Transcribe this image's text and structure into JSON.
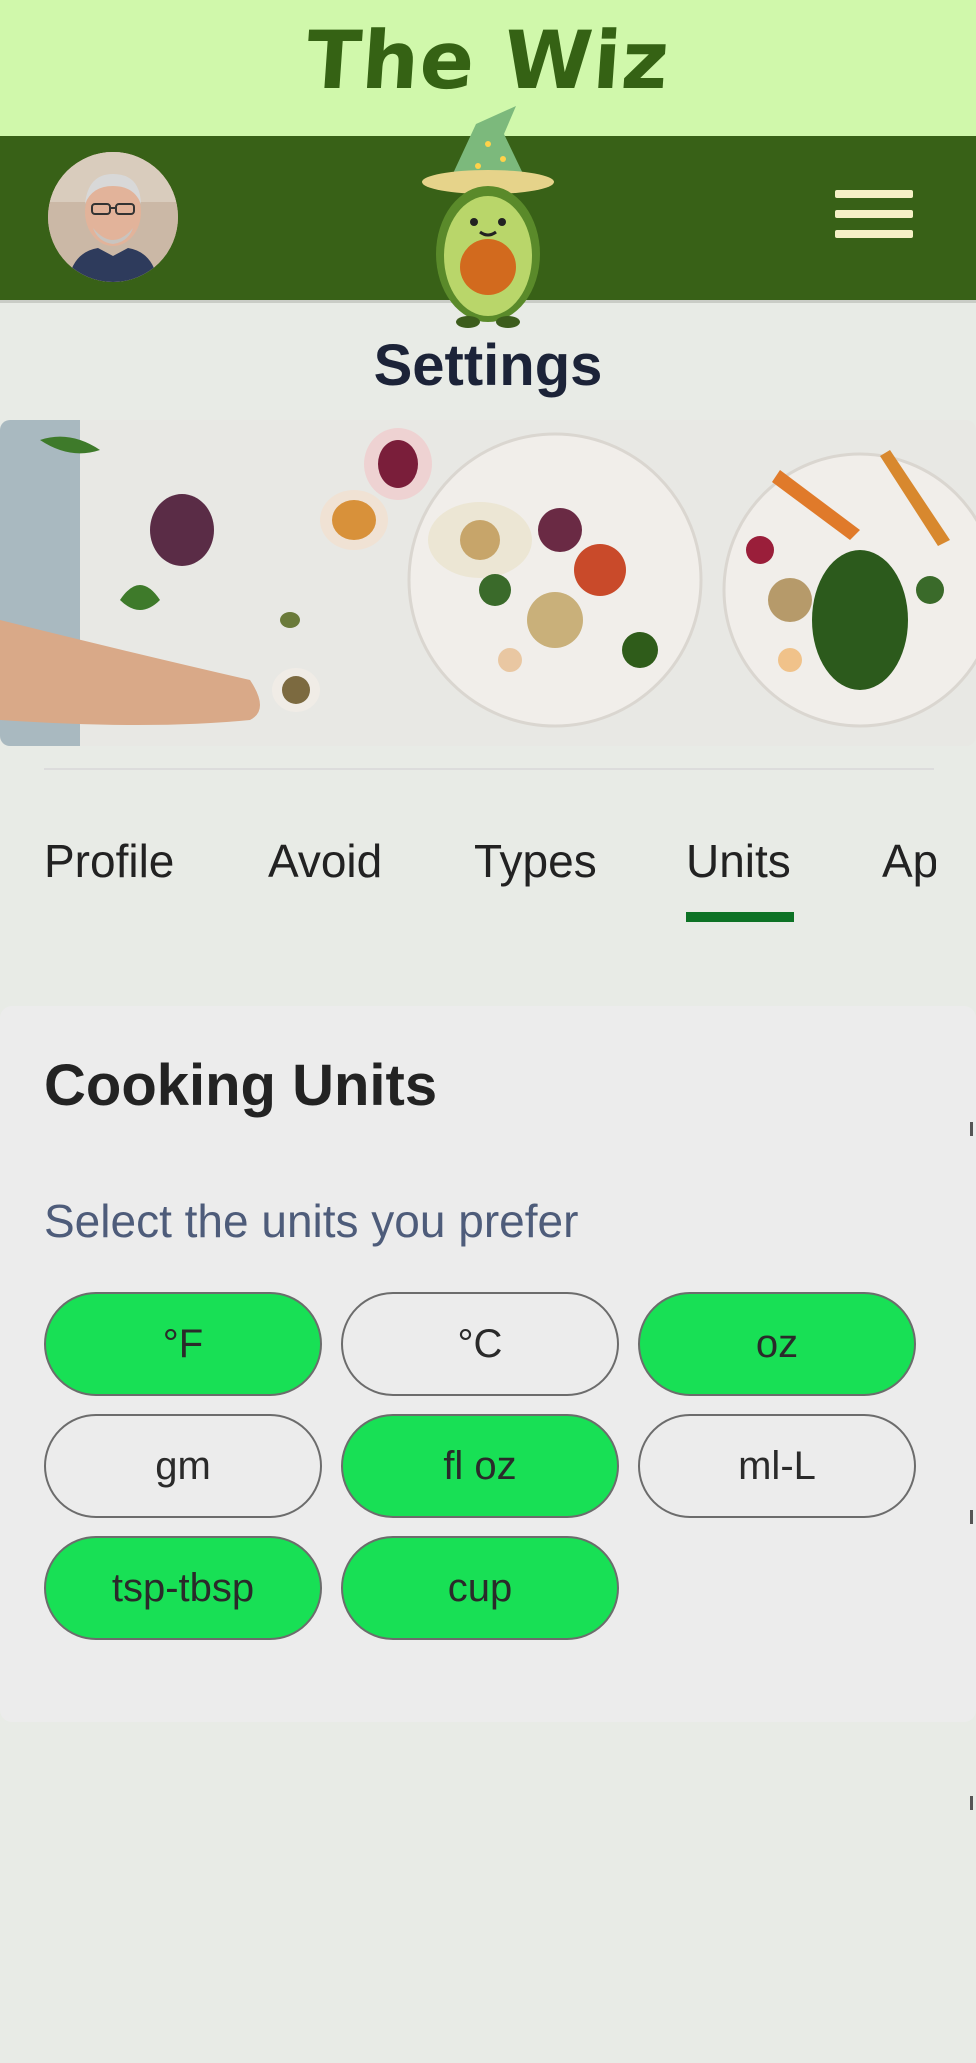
{
  "app": {
    "title": "The Wiz"
  },
  "header": {
    "avatar_alt": "user avatar",
    "menu_icon": "hamburger-menu-icon",
    "mascot": "wizard-avocado-mascot"
  },
  "page": {
    "title": "Settings"
  },
  "tabs": [
    {
      "label": "Profile",
      "selected": false
    },
    {
      "label": "Avoid",
      "selected": false
    },
    {
      "label": "Types",
      "selected": false
    },
    {
      "label": "Units",
      "selected": true
    },
    {
      "label": "Ap",
      "selected": false
    }
  ],
  "section": {
    "title": "Cooking Units",
    "subtitle": "Select the units you prefer"
  },
  "units": [
    {
      "label": "°F",
      "selected": true
    },
    {
      "label": "°C",
      "selected": false
    },
    {
      "label": "oz",
      "selected": true
    },
    {
      "label": "gm",
      "selected": false
    },
    {
      "label": "fl oz",
      "selected": true
    },
    {
      "label": "ml-L",
      "selected": false
    },
    {
      "label": "tsp-tbsp",
      "selected": true
    },
    {
      "label": "cup",
      "selected": true
    }
  ],
  "colors": {
    "banner": "#d0f8ab",
    "header": "#386117",
    "selected_chip": "#18e055",
    "tab_underline": "#0d7225"
  }
}
